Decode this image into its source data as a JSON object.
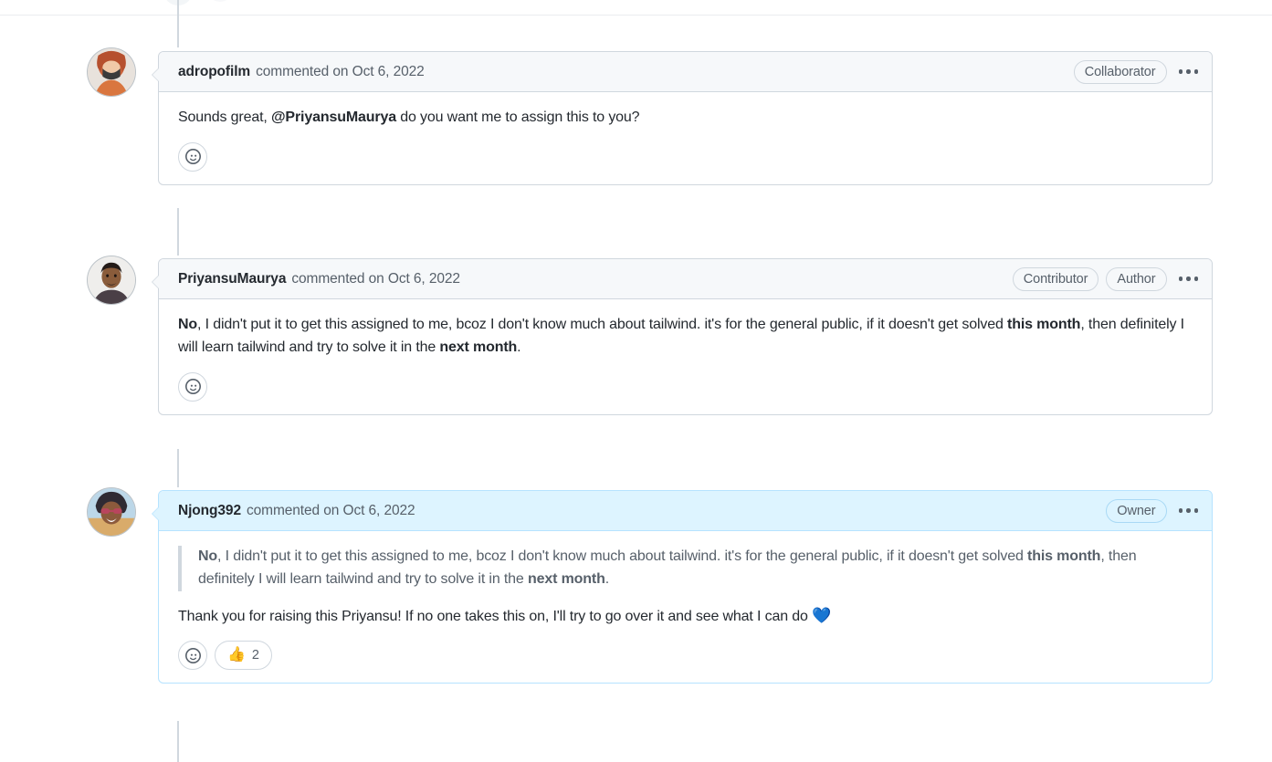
{
  "thread": {
    "rail_icon_names": [
      "timeline-event-icon",
      "timeline-event-icon"
    ],
    "comments": [
      {
        "id": "comment-adropofilm",
        "author": "adropofilm",
        "meta": "commented on Oct 6, 2022",
        "badges": [
          "Collaborator"
        ],
        "menu_name": "comment-actions-menu",
        "avatar_name": "avatar-adropofilm",
        "highlight": false,
        "body": [
          {
            "type": "paragraph",
            "runs": [
              {
                "text": "Sounds great, ",
                "style": "normal"
              },
              {
                "text": "@PriyansuMaurya",
                "style": "mention"
              },
              {
                "text": " do you want me to assign this to you?",
                "style": "normal"
              }
            ]
          }
        ],
        "reactions": {
          "add_label": "add-reaction",
          "items": []
        }
      },
      {
        "id": "comment-priyansumaurya",
        "author": "PriyansuMaurya",
        "meta": "commented on Oct 6, 2022",
        "badges": [
          "Contributor",
          "Author"
        ],
        "menu_name": "comment-actions-menu",
        "avatar_name": "avatar-priyansumaurya",
        "highlight": false,
        "body": [
          {
            "type": "paragraph",
            "runs": [
              {
                "text": "No",
                "style": "bold"
              },
              {
                "text": ", I didn't put it to get this assigned to me, bcoz I don't know much about tailwind. it's for the general public, if it doesn't get solved ",
                "style": "normal"
              },
              {
                "text": "this month",
                "style": "bold"
              },
              {
                "text": ", then definitely I will learn tailwind and try to solve it in the ",
                "style": "normal"
              },
              {
                "text": "next month",
                "style": "bold"
              },
              {
                "text": ".",
                "style": "normal"
              }
            ]
          }
        ],
        "reactions": {
          "add_label": "add-reaction",
          "items": []
        }
      },
      {
        "id": "comment-njong392",
        "author": "Njong392",
        "meta": "commented on Oct 6, 2022",
        "badges": [
          "Owner"
        ],
        "menu_name": "comment-actions-menu",
        "avatar_name": "avatar-njong392",
        "highlight": true,
        "body": [
          {
            "type": "blockquote",
            "runs": [
              {
                "text": "No",
                "style": "bold"
              },
              {
                "text": ", I didn't put it to get this assigned to me, bcoz I don't know much about tailwind. it's for the general public, if it doesn't get solved ",
                "style": "normal"
              },
              {
                "text": "this month",
                "style": "bold"
              },
              {
                "text": ", then definitely I will learn tailwind and try to solve it in the ",
                "style": "normal"
              },
              {
                "text": "next month",
                "style": "bold"
              },
              {
                "text": ".",
                "style": "normal"
              }
            ]
          },
          {
            "type": "paragraph",
            "runs": [
              {
                "text": "Thank you for raising this Priyansu! If no one takes this on, I'll try to go over it and see what I can do ",
                "style": "normal"
              },
              {
                "text": "💙",
                "style": "emoji"
              }
            ]
          }
        ],
        "reactions": {
          "add_label": "add-reaction",
          "items": [
            {
              "emoji": "👍",
              "count": "2",
              "name": "reaction-thumbs-up"
            }
          ]
        }
      }
    ]
  },
  "colors": {
    "border": "#d0d7de",
    "header_bg": "#f6f8fa",
    "owner_header_bg": "#ddf4ff",
    "owner_border": "#b6e3ff",
    "text": "#24292f",
    "muted": "#57606a",
    "heart_blue": "#1f6feb",
    "rail": "#d0d7de"
  }
}
